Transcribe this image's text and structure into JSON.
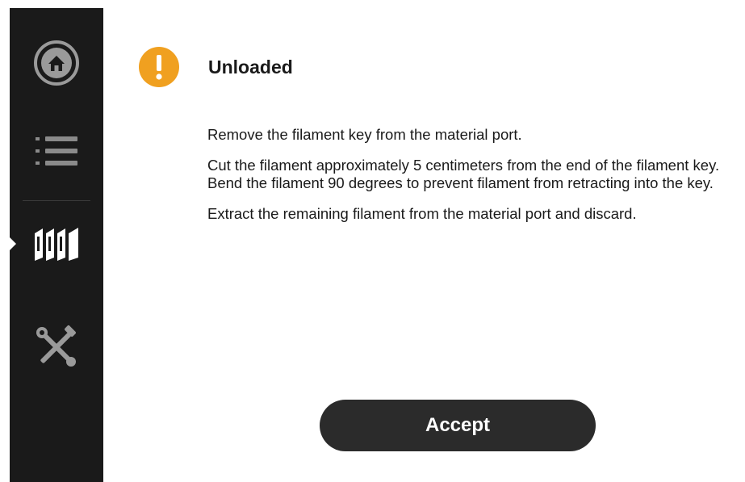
{
  "sidebar": {
    "items": [
      {
        "name": "home",
        "icon": "home-icon"
      },
      {
        "name": "job-queue",
        "icon": "list-icon"
      },
      {
        "name": "materials",
        "icon": "material-bays-icon",
        "active": true
      },
      {
        "name": "tools",
        "icon": "tools-icon"
      }
    ]
  },
  "dialog": {
    "status_icon": "warning-icon",
    "title": "Unloaded",
    "paragraphs": [
      "Remove the filament key from the material port.",
      "Cut the filament approximately 5 centimeters from the end of the filament key. Bend the filament 90 degrees to prevent filament from retracting into the key.",
      "Extract the remaining filament from the material port and discard."
    ],
    "accept_label": "Accept"
  },
  "colors": {
    "sidebar_bg": "#1a1a1a",
    "warning": "#f0a020",
    "button_bg": "#2b2b2b"
  }
}
